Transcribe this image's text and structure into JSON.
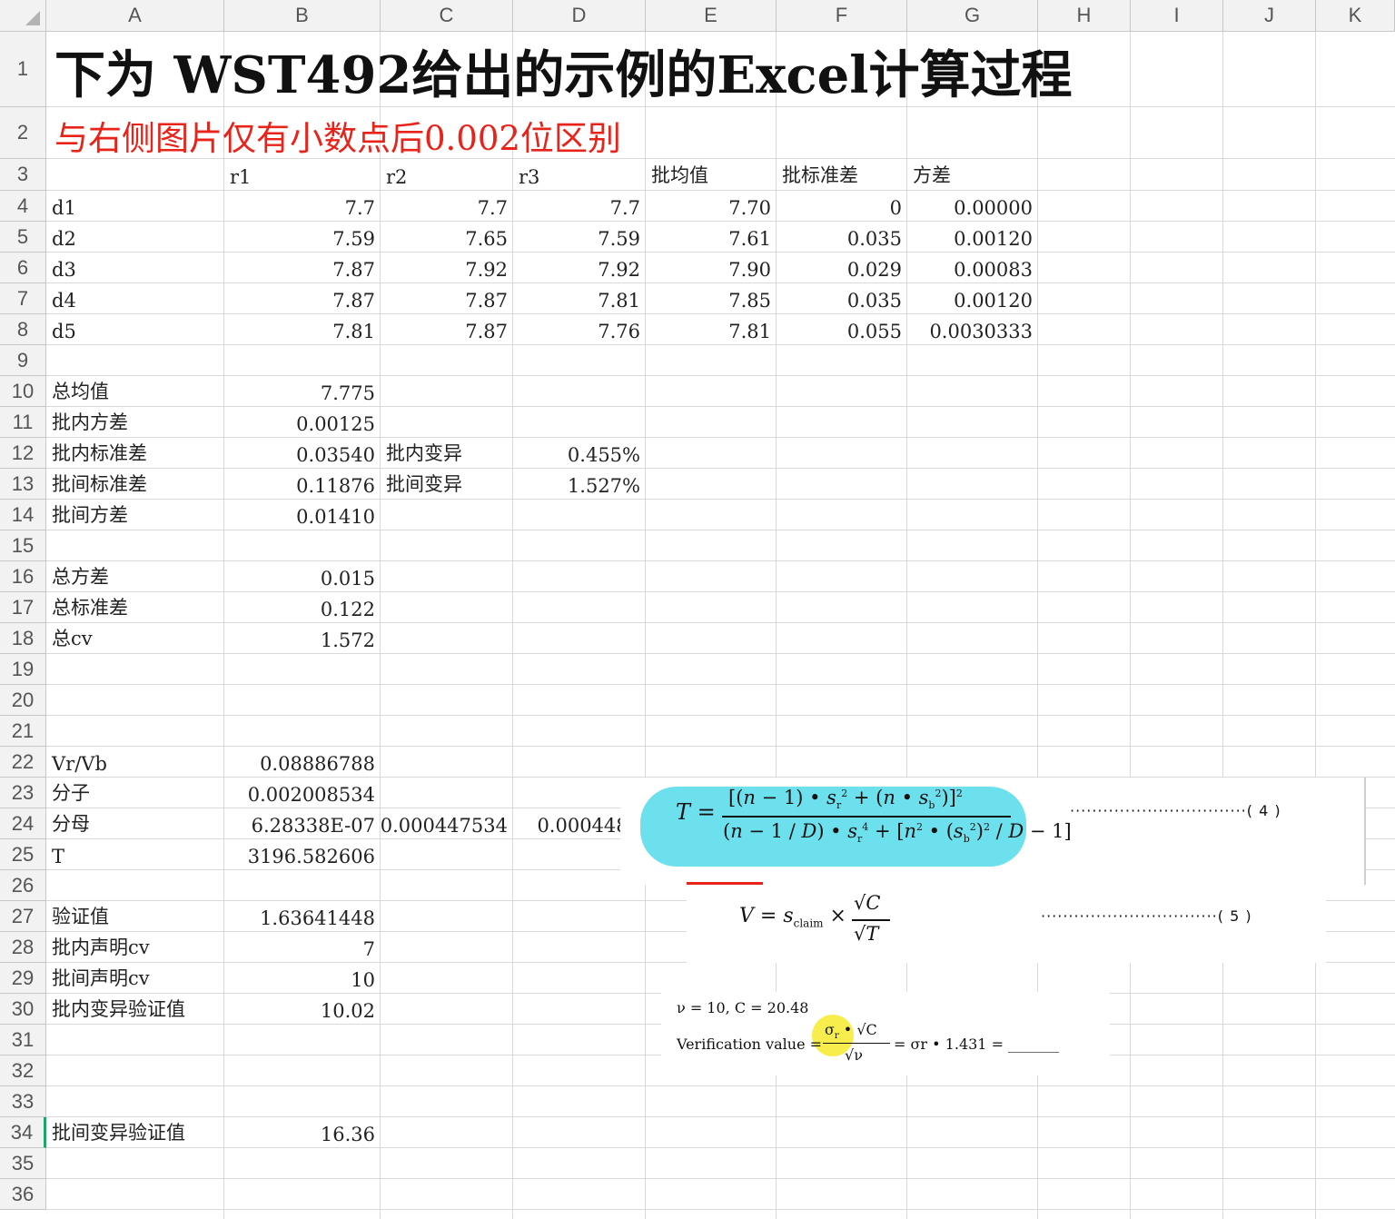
{
  "columns": [
    "A",
    "B",
    "C",
    "D",
    "E",
    "F",
    "G",
    "H",
    "I",
    "J",
    "K"
  ],
  "rows": [
    "1",
    "2",
    "3",
    "4",
    "5",
    "6",
    "7",
    "8",
    "9",
    "10",
    "11",
    "12",
    "13",
    "14",
    "15",
    "16",
    "17",
    "18",
    "19",
    "20",
    "21",
    "22",
    "23",
    "24",
    "25",
    "26",
    "27",
    "28",
    "29",
    "30",
    "31",
    "32",
    "33",
    "34",
    "35",
    "36"
  ],
  "selected_row": "34",
  "title1": "下为 WST492给出的示例的Excel计算过程",
  "title2": "与右侧图片仅有小数点后0.002位区别",
  "header_row": {
    "r1": "r1",
    "r2": "r2",
    "r3": "r3",
    "mean": "批均值",
    "std": "批标准差",
    "var": "方差"
  },
  "data_rows": [
    {
      "label": "d1",
      "r1": "7.7",
      "r2": "7.7",
      "r3": "7.7",
      "mean": "7.70",
      "std": "0",
      "var": "0.00000"
    },
    {
      "label": "d2",
      "r1": "7.59",
      "r2": "7.65",
      "r3": "7.59",
      "mean": "7.61",
      "std": "0.035",
      "var": "0.00120"
    },
    {
      "label": "d3",
      "r1": "7.87",
      "r2": "7.92",
      "r3": "7.92",
      "mean": "7.90",
      "std": "0.029",
      "var": "0.00083"
    },
    {
      "label": "d4",
      "r1": "7.87",
      "r2": "7.87",
      "r3": "7.81",
      "mean": "7.85",
      "std": "0.035",
      "var": "0.00120"
    },
    {
      "label": "d5",
      "r1": "7.81",
      "r2": "7.87",
      "r3": "7.76",
      "mean": "7.81",
      "std": "0.055",
      "var": "0.0030333"
    }
  ],
  "stats": {
    "total_mean_label": "总均值",
    "total_mean": "7.775",
    "within_var_label": "批内方差",
    "within_var": "0.00125",
    "within_sd_label": "批内标准差",
    "within_sd": "0.03540",
    "within_cv_label": "批内变异",
    "within_cv": "0.455%",
    "between_sd_label": "批间标准差",
    "between_sd": "0.11876",
    "between_cv_label": "批间变异",
    "between_cv": "1.527%",
    "between_var_label": "批间方差",
    "between_var": "0.01410",
    "total_var_label": "总方差",
    "total_var": "0.015",
    "total_sd_label": "总标准差",
    "total_sd": "0.122",
    "total_cv_label": "总cv",
    "total_cv": "1.572",
    "vr_vb_label": "Vr/Vb",
    "vr_vb": "0.08886788",
    "numerator_label": "分子",
    "numerator": "0.002008534",
    "denominator_label": "分母",
    "denominator_b": "6.28338E-07",
    "denominator_c": "0.000447534",
    "denominator_d": "0.0004481",
    "t_label": "T",
    "t_value": "3196.582606",
    "verify_label": "验证值",
    "verify_value": "1.63641448",
    "within_claim_label": "批内声明cv",
    "within_claim": "7",
    "between_claim_label": "批间声明cv",
    "between_claim": "10",
    "within_verify_label": "批内变异验证值",
    "within_verify": "10.02",
    "between_verify_label": "批间变异验证值",
    "between_verify": "16.36"
  },
  "formulas": {
    "eq4_number": "( 4 )",
    "eq5_number": "( 5 )",
    "nu_c_line": "ν = 10, C = 20.48",
    "verification_label": "Verification value =",
    "verification_tail": "= σr • 1.431 = _______"
  },
  "colors": {
    "title2": "#e8231a",
    "highlight_cyan": "#6de0ee",
    "highlight_yellow": "#f6ec3a",
    "selection_green": "#21a366"
  }
}
